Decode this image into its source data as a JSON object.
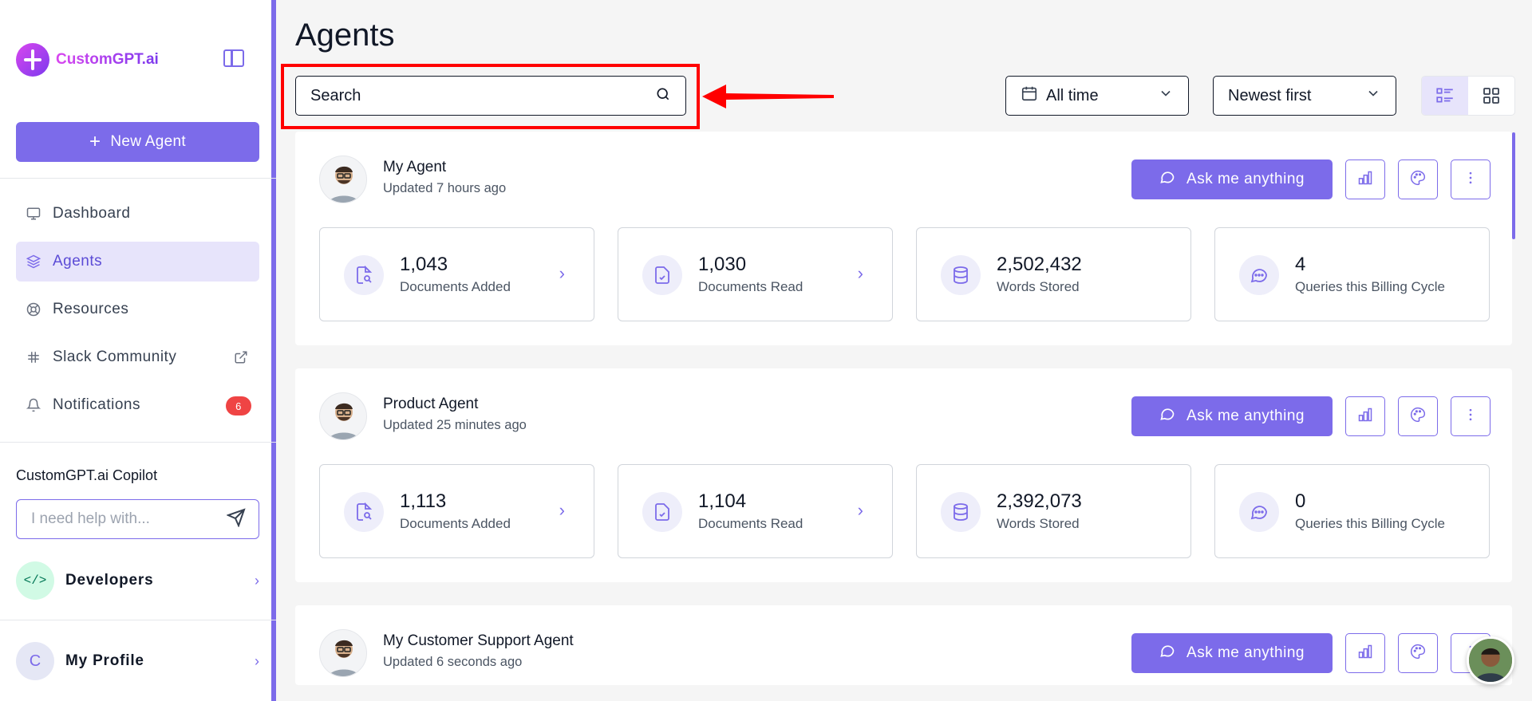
{
  "brand": {
    "name": "CustomGPT.ai"
  },
  "sidebar": {
    "new_agent_label": "New Agent",
    "items": [
      {
        "label": "Dashboard",
        "icon": "monitor-icon"
      },
      {
        "label": "Agents",
        "icon": "layers-icon",
        "active": true
      },
      {
        "label": "Resources",
        "icon": "lifebuoy-icon"
      },
      {
        "label": "Slack Community",
        "icon": "slack-icon"
      },
      {
        "label": "Notifications",
        "icon": "bell-icon",
        "badge": "6"
      }
    ],
    "copilot": {
      "title": "CustomGPT.ai Copilot",
      "placeholder": "I need help with..."
    },
    "developers": {
      "label": "Developers",
      "icon_text": "</>"
    },
    "profile": {
      "label": "My Profile",
      "initial": "C"
    }
  },
  "main": {
    "title": "Agents",
    "search": {
      "placeholder": "Search"
    },
    "filters": {
      "time": "All time",
      "sort": "Newest first"
    }
  },
  "agents": [
    {
      "name": "My Agent",
      "updated": "Updated 7 hours ago",
      "ask_label": "Ask me anything",
      "stats": [
        {
          "value": "1,043",
          "label": "Documents Added"
        },
        {
          "value": "1,030",
          "label": "Documents Read"
        },
        {
          "value": "2,502,432",
          "label": "Words Stored"
        },
        {
          "value": "4",
          "label": "Queries this Billing Cycle"
        }
      ]
    },
    {
      "name": "Product Agent",
      "updated": "Updated 25 minutes ago",
      "ask_label": "Ask me anything",
      "stats": [
        {
          "value": "1,113",
          "label": "Documents Added"
        },
        {
          "value": "1,104",
          "label": "Documents Read"
        },
        {
          "value": "2,392,073",
          "label": "Words Stored"
        },
        {
          "value": "0",
          "label": "Queries this Billing Cycle"
        }
      ]
    },
    {
      "name": "My Customer Support Agent",
      "updated": "Updated 6 seconds ago",
      "ask_label": "Ask me anything"
    }
  ],
  "colors": {
    "accent": "#7c6bea",
    "highlight": "#ff0000",
    "badge": "#ef4444"
  }
}
